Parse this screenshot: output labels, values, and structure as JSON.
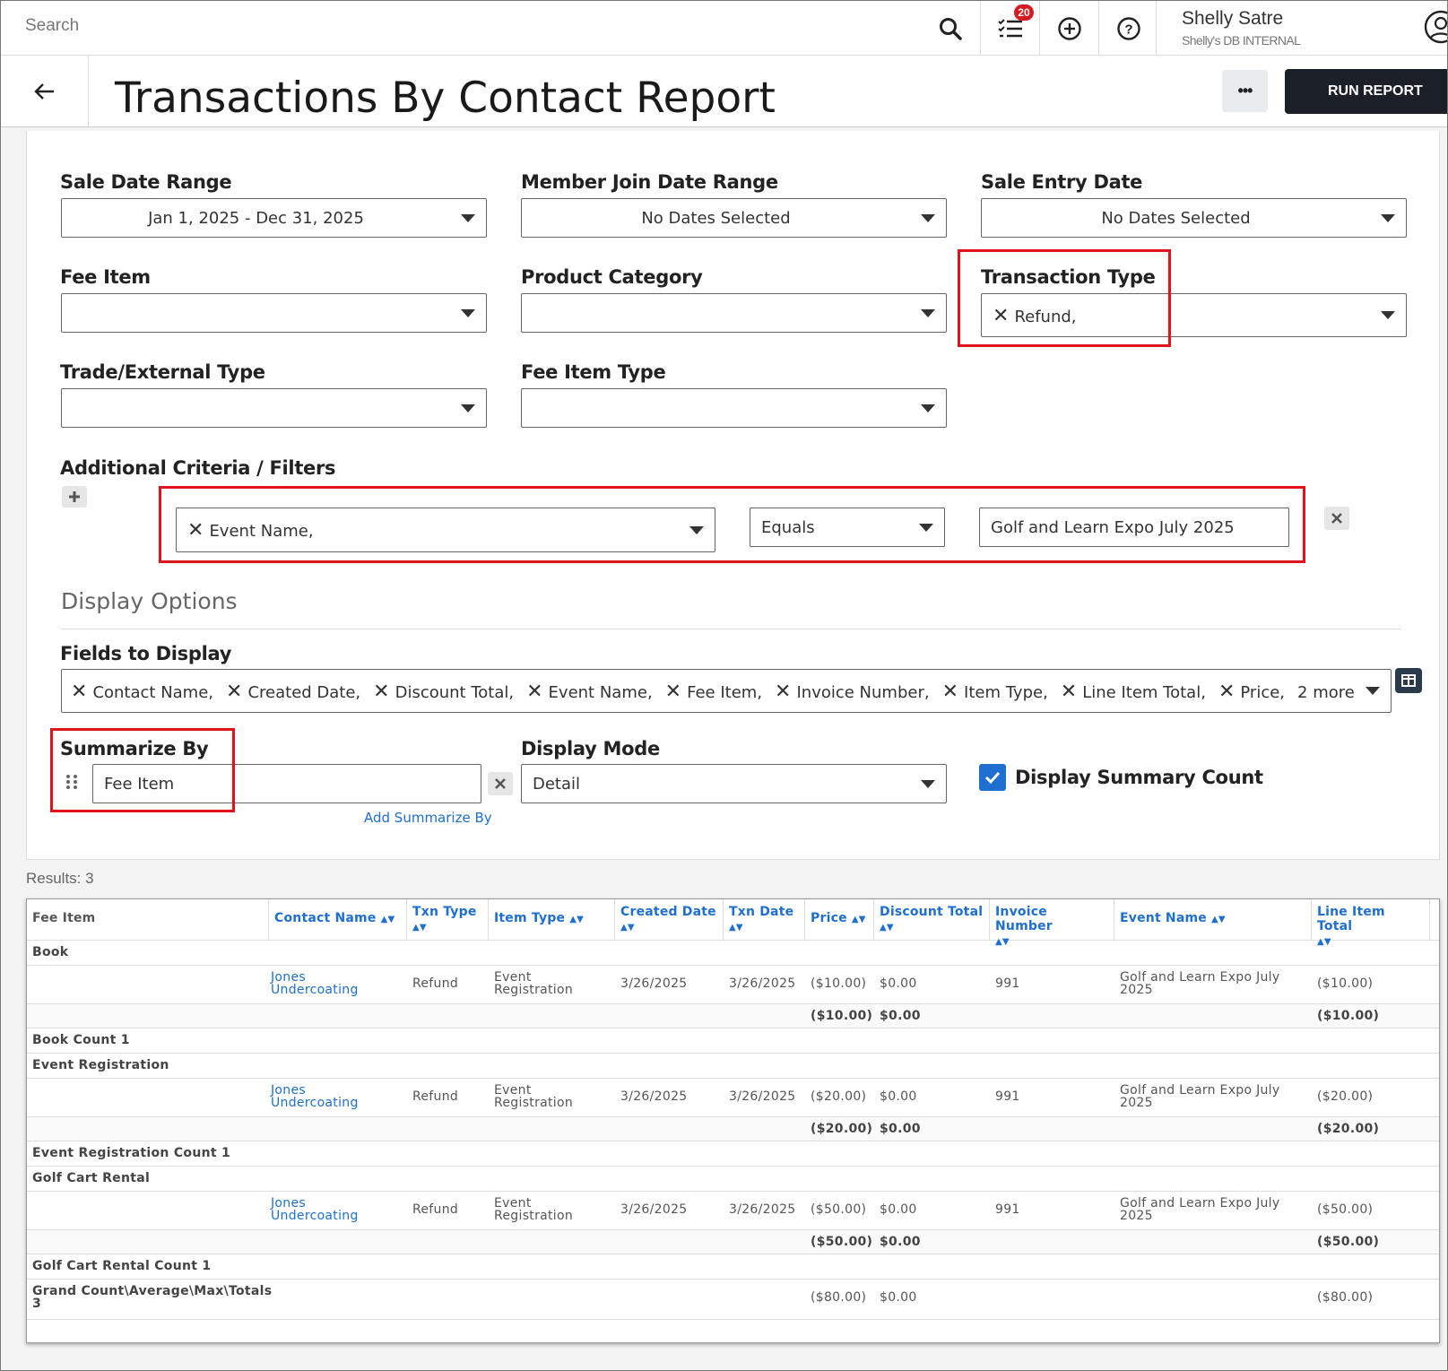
{
  "topbar": {
    "search_placeholder": "Search",
    "notification_count": "20",
    "user_name": "Shelly Satre",
    "user_org": "Shelly's DB INTERNAL"
  },
  "header": {
    "title": "Transactions By Contact Report",
    "more_label": "•••",
    "run_report_label": "RUN REPORT"
  },
  "filters": {
    "sale_date_range": {
      "label": "Sale Date Range",
      "value": "Jan 1, 2025 - Dec 31, 2025"
    },
    "member_join_date_range": {
      "label": "Member Join Date Range",
      "value": "No Dates Selected"
    },
    "sale_entry_date": {
      "label": "Sale Entry Date",
      "value": "No Dates Selected"
    },
    "fee_item": {
      "label": "Fee Item",
      "value": ""
    },
    "product_category": {
      "label": "Product Category",
      "value": ""
    },
    "transaction_type": {
      "label": "Transaction Type",
      "value": "Refund,"
    },
    "trade_external_type": {
      "label": "Trade/External Type",
      "value": ""
    },
    "fee_item_type": {
      "label": "Fee Item Type",
      "value": ""
    }
  },
  "additional_criteria": {
    "label": "Additional Criteria / Filters",
    "field": "Event Name,",
    "operator": "Equals",
    "value": "Golf and Learn Expo July 2025"
  },
  "display_options": {
    "heading": "Display Options",
    "fields_label": "Fields to Display",
    "fields": [
      "Contact Name,",
      "Created Date,",
      "Discount Total,",
      "Event Name,",
      "Fee Item,",
      "Invoice Number,",
      "Item Type,",
      "Line Item Total,",
      "Price,"
    ],
    "more_text": "2 more",
    "summarize_label": "Summarize By",
    "summarize_value": "Fee Item",
    "add_summarize_label": "Add Summarize By",
    "display_mode_label": "Display Mode",
    "display_mode_value": "Detail",
    "summary_count_label": "Display Summary Count",
    "summary_count_checked": true
  },
  "results": {
    "label": "Results: 3",
    "columns": [
      "Fee Item",
      "Contact Name",
      "Txn Type",
      "Item Type",
      "Created Date",
      "Txn Date",
      "Price",
      "Discount Total",
      "Invoice Number",
      "Event Name",
      "Line Item Total"
    ],
    "groups": [
      {
        "name": "Book",
        "row": {
          "contact_1": "Jones",
          "contact_2": "Undercoating",
          "txn_type": "Refund",
          "item_type_1": "Event",
          "item_type_2": "Registration",
          "created": "3/26/2025",
          "txn_date": "3/26/2025",
          "price": "($10.00)",
          "discount": "$0.00",
          "invoice": "991",
          "event_1": "Golf and Learn Expo July",
          "event_2": "2025",
          "line_total": "($10.00)"
        },
        "subtotal": {
          "price": "($10.00)",
          "discount": "$0.00",
          "line_total": "($10.00)"
        },
        "count": "Book Count 1"
      },
      {
        "name": "Event Registration",
        "row": {
          "contact_1": "Jones",
          "contact_2": "Undercoating",
          "txn_type": "Refund",
          "item_type_1": "Event",
          "item_type_2": "Registration",
          "created": "3/26/2025",
          "txn_date": "3/26/2025",
          "price": "($20.00)",
          "discount": "$0.00",
          "invoice": "991",
          "event_1": "Golf and Learn Expo July",
          "event_2": "2025",
          "line_total": "($20.00)"
        },
        "subtotal": {
          "price": "($20.00)",
          "discount": "$0.00",
          "line_total": "($20.00)"
        },
        "count": "Event Registration Count 1"
      },
      {
        "name": "Golf Cart Rental",
        "row": {
          "contact_1": "Jones",
          "contact_2": "Undercoating",
          "txn_type": "Refund",
          "item_type_1": "Event",
          "item_type_2": "Registration",
          "created": "3/26/2025",
          "txn_date": "3/26/2025",
          "price": "($50.00)",
          "discount": "$0.00",
          "invoice": "991",
          "event_1": "Golf and Learn Expo July",
          "event_2": "2025",
          "line_total": "($50.00)"
        },
        "subtotal": {
          "price": "($50.00)",
          "discount": "$0.00",
          "line_total": "($50.00)"
        },
        "count": "Golf Cart Rental Count 1"
      }
    ],
    "grand": {
      "label_1": "Grand Count\\Average\\Max\\Totals",
      "label_2": "3",
      "price": "($80.00)",
      "discount": "$0.00",
      "line_total": "($80.00)"
    }
  },
  "colors": {
    "accent": "#1e6fd0",
    "highlight": "#e0121b",
    "dark_button": "#1b1f27",
    "badge": "#d71920"
  }
}
